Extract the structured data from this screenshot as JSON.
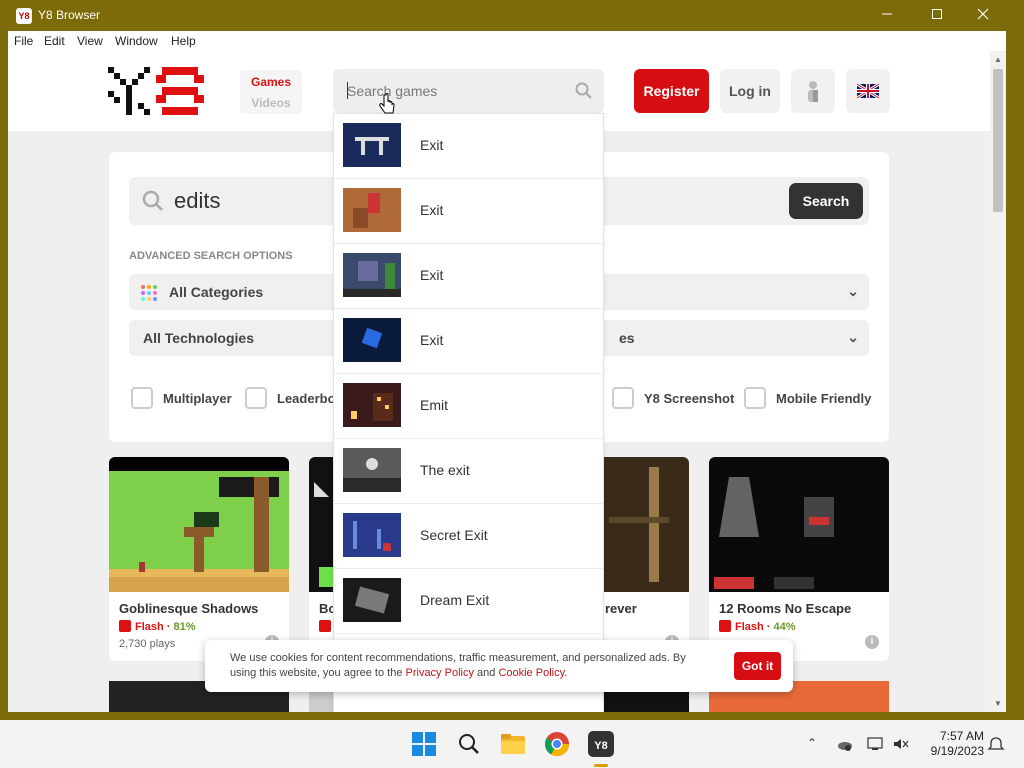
{
  "window": {
    "title": "Y8 Browser",
    "app_icon_text": "Y8",
    "minimize": "—",
    "maximize": "□",
    "close": "✕"
  },
  "menu": [
    "File",
    "Edit",
    "View",
    "Window",
    "Help"
  ],
  "header": {
    "tab_games": "Games",
    "tab_videos": "Videos",
    "search_placeholder": "Search games",
    "register": "Register",
    "login": "Log in",
    "user_icon": "user-icon",
    "language_icon": "uk-flag-icon"
  },
  "dropdown": {
    "items": [
      {
        "label": "Exit",
        "thumb_color": "#1a2a5a"
      },
      {
        "label": "Exit",
        "thumb_color": "#b06a3a"
      },
      {
        "label": "Exit",
        "thumb_color": "#3a4a6a"
      },
      {
        "label": "Exit",
        "thumb_color": "#0a1a3a"
      },
      {
        "label": "Emit",
        "thumb_color": "#3a1a1a"
      },
      {
        "label": "The exit",
        "thumb_color": "#5a5a5a"
      },
      {
        "label": "Secret Exit",
        "thumb_color": "#2a3a8a"
      },
      {
        "label": "Dream Exit",
        "thumb_color": "#1a1a1a"
      }
    ]
  },
  "search_panel": {
    "query": "edits",
    "search_button": "Search",
    "advanced_label": "ADVANCED SEARCH OPTIONS",
    "categories": "All Categories",
    "technologies": "All Technologies",
    "types_partial": "es",
    "checkboxes": [
      "Multiplayer",
      "Leaderboa",
      "Y8 Screenshot",
      "Mobile Friendly"
    ]
  },
  "games": [
    {
      "title": "Goblinesque Shadows",
      "tech": "Flash",
      "rating": "81%",
      "plays": "2,730 plays"
    },
    {
      "title": "Bo",
      "tech": "",
      "rating": "",
      "plays": ""
    },
    {
      "title": "rever",
      "tech": "",
      "rating": "",
      "plays": ""
    },
    {
      "title": "12 Rooms No Escape",
      "tech": "Flash",
      "rating": "44%",
      "plays": ""
    }
  ],
  "cookie": {
    "text_before": "We use cookies for content recommendations, traffic measurement, and personalized ads. By using this website, you agree to the ",
    "privacy_link": "Privacy Policy",
    "and": " and ",
    "cookie_link": "Cookie Policy",
    "end": ".",
    "button": "Got it"
  },
  "taskbar": {
    "time": "7:57 AM",
    "date": "9/19/2023",
    "apps": [
      "windows-start-icon",
      "search-icon",
      "file-explorer-icon",
      "chrome-icon",
      "y8-browser-icon"
    ]
  },
  "colors": {
    "brand_red": "#d60d12",
    "titlebar": "#7d6a08"
  }
}
